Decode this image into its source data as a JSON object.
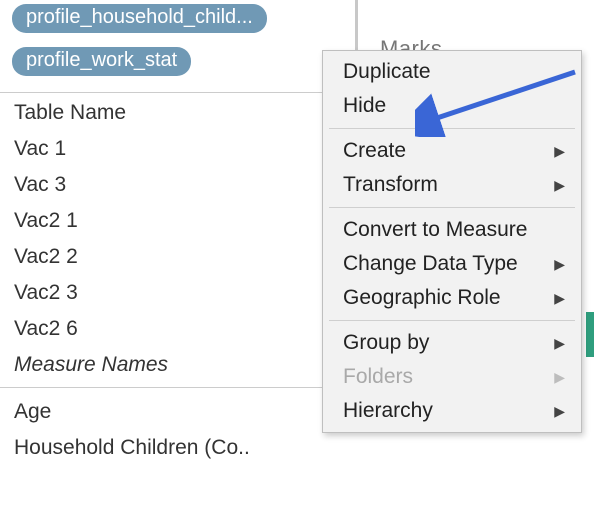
{
  "pills": {
    "p1": "profile_household_child...",
    "p2": "profile_work_stat"
  },
  "fields": {
    "f0": "Table Name",
    "f1": "Vac 1",
    "f2": "Vac 3",
    "f3": "Vac2 1",
    "f4": "Vac2 2",
    "f5": "Vac2 3",
    "f6": "Vac2 6",
    "f7": "Measure Names",
    "f8": "Age",
    "f9": "Household Children (Co.."
  },
  "right": {
    "marks_hint": "Marks"
  },
  "menu": {
    "duplicate": "Duplicate",
    "hide": "Hide",
    "create": "Create",
    "transform": "Transform",
    "convert": "Convert to Measure",
    "changetype": "Change Data Type",
    "georole": "Geographic Role",
    "groupby": "Group by",
    "folders": "Folders",
    "hierarchy": "Hierarchy"
  }
}
